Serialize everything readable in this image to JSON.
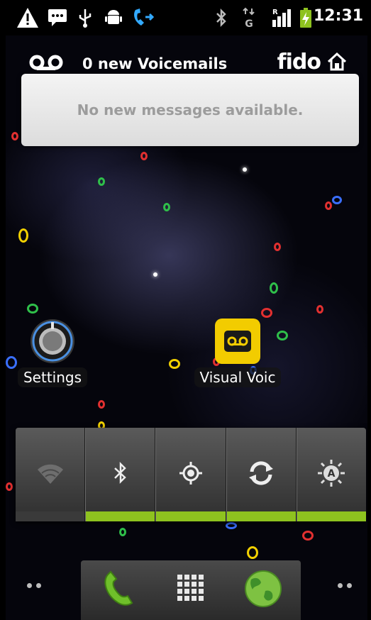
{
  "status_bar": {
    "time": "12:31",
    "icons": [
      "warning-icon",
      "sms-icon",
      "usb-icon",
      "android-debug-icon",
      "phone-call-icon",
      "bluetooth-icon",
      "data-g-icon",
      "signal-icon",
      "battery-charging-icon"
    ],
    "network_letter": "G",
    "roaming_letter": "R"
  },
  "voicemail_widget": {
    "title": "0 new Voicemails",
    "carrier": "fido",
    "message": "No new messages available."
  },
  "desktop": {
    "apps": [
      {
        "label": "Settings"
      },
      {
        "label": "Visual Voic"
      }
    ]
  },
  "power_control": {
    "toggles": [
      {
        "name": "wifi",
        "on": false
      },
      {
        "name": "bluetooth",
        "on": true
      },
      {
        "name": "gps",
        "on": true
      },
      {
        "name": "sync",
        "on": true
      },
      {
        "name": "brightness",
        "on": true
      }
    ],
    "brightness_letter": "A"
  },
  "dock": {
    "items": [
      "phone-icon",
      "app-drawer-icon",
      "browser-icon"
    ]
  },
  "colors": {
    "accent_green": "#8ec21f",
    "voicemail_yellow": "#f2cc00"
  }
}
